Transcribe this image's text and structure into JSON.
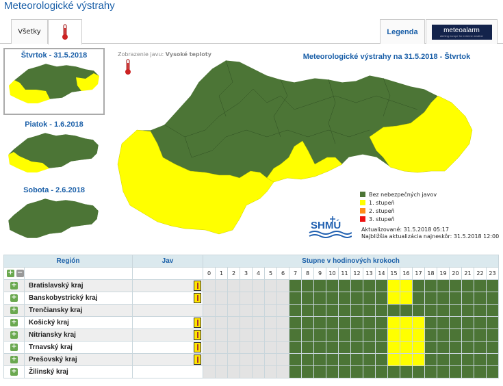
{
  "page": {
    "title": "Meteorologické výstrahy"
  },
  "tabs": {
    "all_label": "Všetky",
    "legend_label": "Legenda",
    "meteoalarm_label": "meteoalarm",
    "meteoalarm_sub": "alerting europe for extreme weather"
  },
  "thumbnails": [
    {
      "label": "Štvrtok - 31.5.2018",
      "selected": true
    },
    {
      "label": "Piatok - 1.6.2018",
      "selected": false
    },
    {
      "label": "Sobota - 2.6.2018",
      "selected": false
    }
  ],
  "display": {
    "prefix": "Zobrazenie javu:",
    "value": "Vysoké teploty"
  },
  "map": {
    "title": "Meteorologické výstrahy na 31.5.2018 - Štvrtok"
  },
  "legend": {
    "items": [
      {
        "label": "Bez nebezpečných javov",
        "color": "#4c7536"
      },
      {
        "label": "1. stupeň",
        "color": "#ffff00"
      },
      {
        "label": "2. stupeň",
        "color": "#ff8c1a"
      },
      {
        "label": "3. stupeň",
        "color": "#ee1111"
      }
    ]
  },
  "update": {
    "updated": "Aktualizované: 31.5.2018 05:17",
    "next": "Najbližšia aktualizácia najneskôr: 31.5.2018 12:00"
  },
  "shmu_logo": "SHMÚ",
  "table": {
    "headers": {
      "region": "Región",
      "jav": "Jav",
      "steps": "Stupne v hodinových krokoch"
    },
    "hours": [
      "0",
      "1",
      "2",
      "3",
      "4",
      "5",
      "6",
      "7",
      "8",
      "9",
      "10",
      "11",
      "12",
      "13",
      "14",
      "15",
      "16",
      "17",
      "18",
      "19",
      "20",
      "21",
      "22",
      "23"
    ],
    "rows": [
      {
        "name": "Bratislavský kraj",
        "has_icon": true,
        "yellow": [
          15,
          16
        ]
      },
      {
        "name": "Banskobystrický kraj",
        "has_icon": true,
        "yellow": [
          15,
          16
        ]
      },
      {
        "name": "Trenčiansky kraj",
        "has_icon": false,
        "yellow": []
      },
      {
        "name": "Košický kraj",
        "has_icon": true,
        "yellow": [
          15,
          16,
          17
        ]
      },
      {
        "name": "Nitriansky kraj",
        "has_icon": true,
        "yellow": [
          15,
          16,
          17
        ]
      },
      {
        "name": "Trnavský kraj",
        "has_icon": true,
        "yellow": [
          15,
          16,
          17
        ]
      },
      {
        "name": "Prešovský kraj",
        "has_icon": true,
        "yellow": [
          15,
          16,
          17
        ]
      },
      {
        "name": "Žilinský kraj",
        "has_icon": false,
        "yellow": []
      }
    ],
    "first_green_hour": 7
  },
  "colors": {
    "accent": "#1a5fa8",
    "green": "#4c7536",
    "yellow": "#ffff00"
  }
}
